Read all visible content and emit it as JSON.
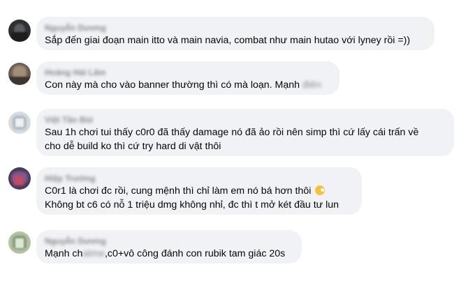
{
  "comments": [
    {
      "author": "Nguyễn Dương",
      "lines": [
        "Sắp đến giai đoạn main itto và main navia, combat như main hutao với lyney rồi =))"
      ]
    },
    {
      "author": "Hoàng Hải Lâm",
      "lines": [
        "Con này mà cho vào banner thường thì có mà loạn. Mạnh"
      ],
      "blurred_suffix": "điên"
    },
    {
      "author": "Việt Tân Bùi",
      "lines": [
        "Sau 1h chơi tui thấy c0r0 đã thấy damage nó đã ảo rồi nên simp thì cứ lấy cái trấn về",
        "cho dễ build ko thì cứ try hard di vật thôi"
      ]
    },
    {
      "author": "Hiệp Trường",
      "lines": [
        "C0r1 là chơi đc rồi, cung mệnh thì chỉ làm em nó bá hơn thôi",
        "Không bt c6 có nỗ 1 triệu dmg không nhỉ, đc thì t mở két đầu tư lun"
      ],
      "emoji": "moon-cake-emoji"
    },
    {
      "author": "Nguyễn Dương",
      "text_before": "Mạnh ch",
      "blurred_mid": "atme",
      "text_after": ",c0+vô công đánh con rubik tam giác 20s"
    }
  ]
}
